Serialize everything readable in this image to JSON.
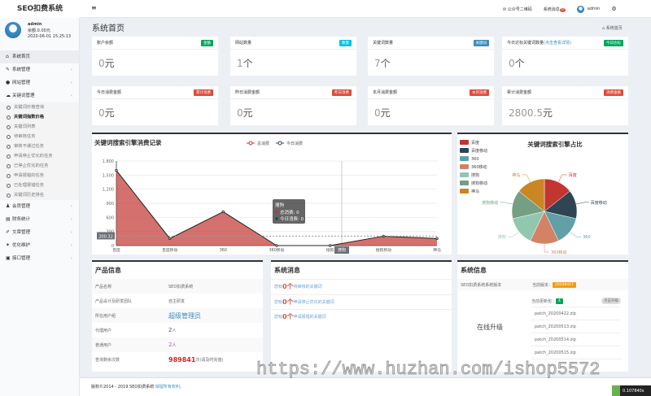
{
  "app": {
    "title": "SEO扣费系统"
  },
  "user": {
    "name": "admin",
    "balance": "余额:0.00元",
    "time": "2020-06-01 15:25:13"
  },
  "sidebar": {
    "items": [
      {
        "label": "系统首页",
        "icon": "home-icon",
        "glyph": "⌂"
      },
      {
        "label": "系统管理",
        "icon": "wrench-icon",
        "glyph": "✎"
      },
      {
        "label": "网站管理",
        "icon": "circle-icon",
        "glyph": "●"
      },
      {
        "label": "关键词管理",
        "icon": "cloud-icon",
        "glyph": "☁"
      }
    ],
    "sub": [
      "关键词价格查询",
      "关键词指数价格",
      "关键词列表",
      "待审核任务",
      "审核不通过任务",
      "申请停止优化的任务",
      "已停止优化的任务",
      "申请报错的任务",
      "已处理报错任务",
      "关键词历史排名"
    ],
    "items2": [
      {
        "label": "会员管理",
        "icon": "users-icon",
        "glyph": "♟"
      },
      {
        "label": "财务统计",
        "icon": "card-icon",
        "glyph": "▤"
      },
      {
        "label": "文章管理",
        "icon": "edit-icon",
        "glyph": "✐"
      },
      {
        "label": "优化维护",
        "icon": "tools-icon",
        "glyph": "✦"
      },
      {
        "label": "接口管理",
        "icon": "print-icon",
        "glyph": "▣"
      }
    ]
  },
  "topbar": {
    "menu": "≡",
    "wechat": "公众号二维码",
    "messages": "系统消息",
    "msg_count": "0",
    "user": "admin"
  },
  "page": {
    "title": "系统首页",
    "breadcrumb": "系统首页"
  },
  "cards": [
    {
      "label": "账户余额",
      "badge": "金额",
      "color": "#00a65a",
      "num": "0",
      "unit": "元"
    },
    {
      "label": "网站数量",
      "badge": "数量",
      "color": "#00c0ef",
      "num": "1",
      "unit": "个"
    },
    {
      "label": "关键词数量",
      "badge": "关键词",
      "color": "#3c8dbc",
      "num": "7",
      "unit": "个"
    },
    {
      "label": "今日达标关键词数量",
      "link": "(点击查看详情)",
      "badge": "今日达标",
      "color": "#00a65a",
      "num": "0",
      "unit": "个"
    },
    {
      "label": "今日消费金额",
      "badge": "累计消费",
      "color": "#dd4b39",
      "num": "0",
      "unit": "元"
    },
    {
      "label": "昨日消费金额",
      "badge": "昨日消费",
      "color": "#dd4b39",
      "num": "0",
      "unit": "元"
    },
    {
      "label": "本月消费金额",
      "badge": "本月消费",
      "color": "#dd4b39",
      "num": "0",
      "unit": "元"
    },
    {
      "label": "累计消费金额",
      "badge": "消费金额",
      "color": "#dd4b39",
      "num": "2800.5",
      "unit": "元"
    }
  ],
  "chart_data": [
    {
      "type": "area",
      "title": "关键词搜索引擎消费记录",
      "categories": [
        "百度",
        "百度移动",
        "360",
        "360移动",
        "搜狗",
        "搜狗移动",
        "神马"
      ],
      "series": [
        {
          "name": "总消费",
          "values": [
            1600,
            150,
            720,
            0,
            0,
            200,
            150
          ],
          "color": "#c23531"
        },
        {
          "name": "今日消费",
          "values": [
            0,
            0,
            0,
            0,
            0,
            0,
            0
          ],
          "color": "#2f4554"
        }
      ],
      "ylim": [
        0,
        1800
      ],
      "yticks": [
        0,
        300,
        600,
        900,
        1200,
        1500,
        1800
      ],
      "yticks_labels": [
        "0",
        "300",
        "600",
        "900",
        "1,200",
        "1,500",
        "1,800"
      ],
      "markline": "200.32",
      "tooltip": {
        "title": "搜狗",
        "lines": [
          "总消费: 0",
          "今日消费: 0"
        ]
      },
      "axis_pointer": "搜狗"
    },
    {
      "type": "pie",
      "title": "关键词搜索引擎占比",
      "categories": [
        "百度",
        "百度移动",
        "360",
        "360移动",
        "搜狗",
        "搜狗移动",
        "神马"
      ],
      "values": [
        1,
        1,
        1,
        1,
        1,
        1,
        1
      ],
      "colors": [
        "#c23531",
        "#2f4554",
        "#61a0a8",
        "#d48265",
        "#91c7ae",
        "#749f83",
        "#ca8622"
      ],
      "legend": "top-left"
    }
  ],
  "product": {
    "title": "产品信息",
    "rows": [
      {
        "k": "产品名称",
        "v": "SEO扣费系统"
      },
      {
        "k": "产品设计及研发团队",
        "v": "自主研发"
      },
      {
        "k": "所在用户组",
        "v": "超级管理员"
      },
      {
        "k": "代理用户",
        "v": "2",
        "u": "人"
      },
      {
        "k": "普通用户",
        "v": "2",
        "u": "人"
      },
      {
        "k": "查询剩余次数",
        "v": "989841",
        "u": "次(请及时充值)"
      }
    ]
  },
  "messages": {
    "title": "系统消息",
    "prefix": "您有",
    "count": "0个",
    "items": [
      "待审核的关键词",
      "申请停止优化的关键词",
      "申请报错的关键词"
    ]
  },
  "sysinfo": {
    "title": "系统信息",
    "version_label": "SEO扣费系统系统版本",
    "current_label": "当前版本：",
    "version": "20200417",
    "upgrade": "在线升级",
    "packages_label": "当前更新包：",
    "packages_count": "4",
    "upgrade_btn": "点击升级",
    "patches": [
      "patch_20200422.zip",
      "patch_20200513.zip",
      "patch_20200514.zip",
      "patch_20200515.zip"
    ]
  },
  "footer": {
    "copyright": "版权©2014 - 2019 SEO扣费系统.",
    "rights": "保留所有权利。"
  },
  "timer": "0.107840s",
  "watermark": "https://www.huzhan.com/ishop5572"
}
